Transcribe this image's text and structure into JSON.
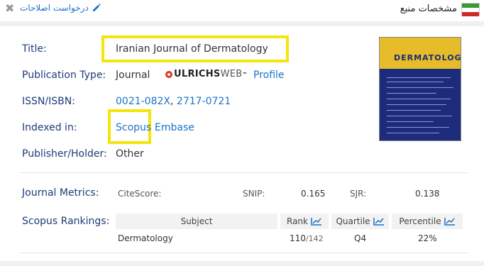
{
  "header": {
    "panel_title": "مشخصات منبع",
    "edit_link": "درخواست اصلاحات",
    "close_glyph": "✖",
    "flag_colors": [
      "#3a9a3a",
      "#ffffff",
      "#cc2a2a"
    ]
  },
  "info": {
    "title_label": "Title:",
    "title_value": "Iranian Journal of Dermatology",
    "pubtype_label": "Publication Type:",
    "pubtype_value": "Journal",
    "ulrichs_brand": "ULRICHS",
    "ulrichs_web": "WEB",
    "ulrichs_tm": "™",
    "profile_link": "Profile",
    "issn_label": "ISSN/ISBN:",
    "issn_1": "0021-082X",
    "issn_sep": ",",
    "issn_2": "2717-0721",
    "indexed_label": "Indexed in:",
    "indexed_1": "Scopus",
    "indexed_2": "Embase",
    "publisher_label": "Publisher/Holder:",
    "publisher_value": "Other"
  },
  "cover": {
    "logo_text": "DERMATOLOGY"
  },
  "metrics": {
    "label": "Journal Metrics:",
    "citescore_key": "CiteScore:",
    "citescore_val": "",
    "snip_key": "SNIP:",
    "snip_val": "0.165",
    "sjr_key": "SJR:",
    "sjr_val": "0.138"
  },
  "rankings": {
    "label": "Scopus Rankings:",
    "headers": {
      "subject": "Subject",
      "rank": "Rank",
      "quartile": "Quartile",
      "percentile": "Percentile"
    },
    "rows": [
      {
        "subject": "Dermatology",
        "rank": "110",
        "rank_total": "/142",
        "quartile": "Q4",
        "percentile": "22%"
      }
    ]
  },
  "colors": {
    "label_blue": "#1e3b78",
    "link_blue": "#1a73c8",
    "highlight_yellow": "#f5e50a"
  }
}
